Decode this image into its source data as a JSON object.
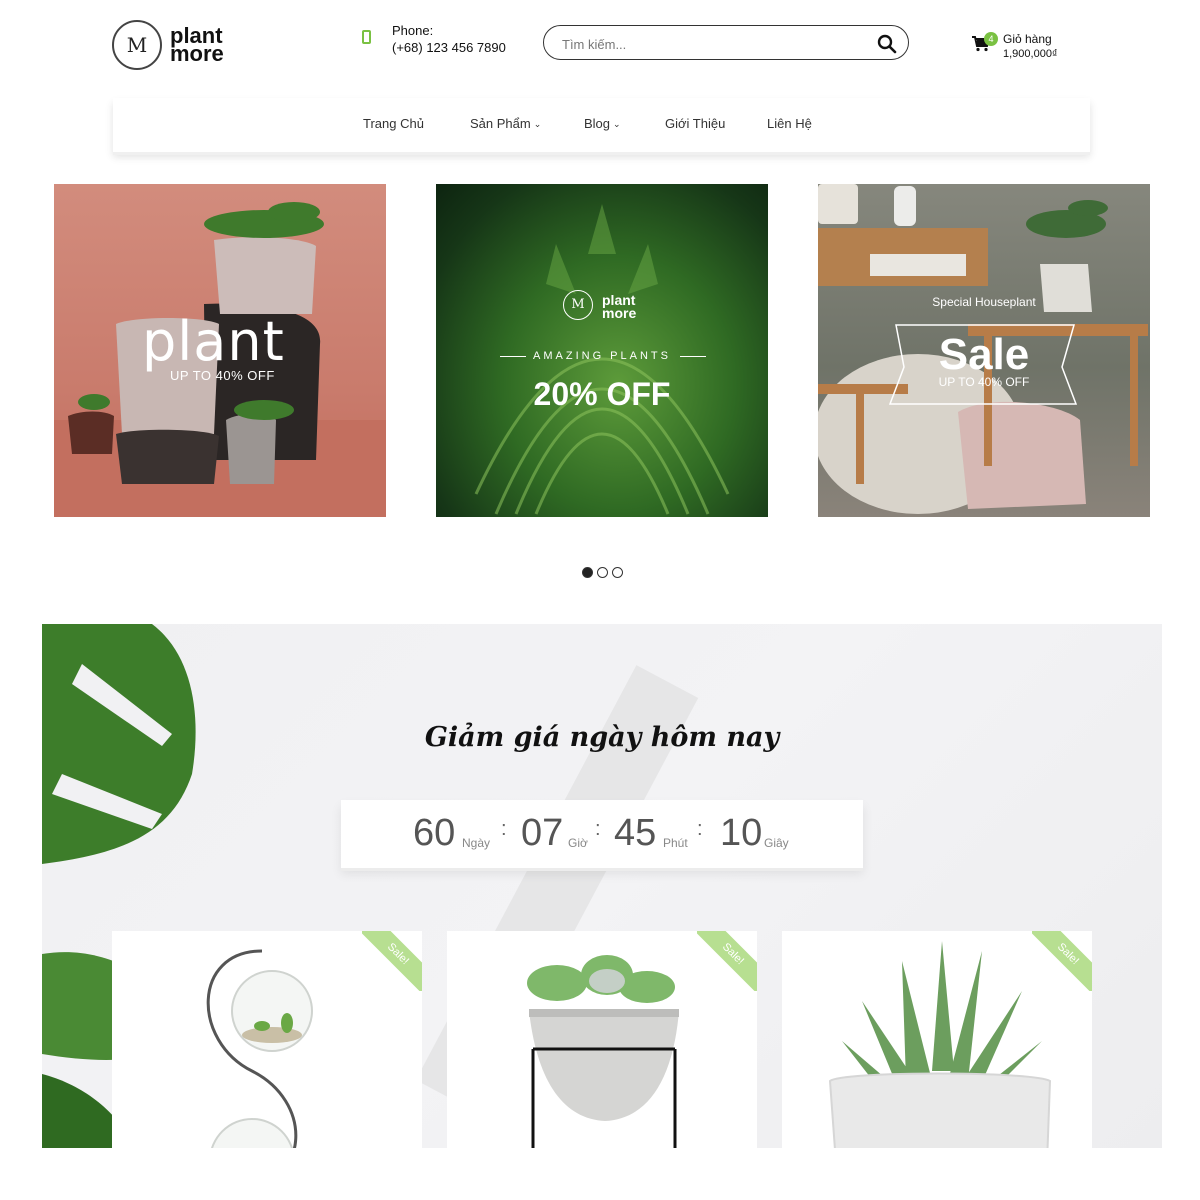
{
  "header": {
    "logo_line1": "plant",
    "logo_line2": "more",
    "logo_letter": "M",
    "phone_label": "Phone:",
    "phone_number": "(+68) 123 456 7890",
    "search_placeholder": "Tìm kiếm...",
    "cart_label": "Giỏ hàng",
    "cart_total": "1,900,000₫",
    "cart_count": "4"
  },
  "nav": {
    "items": [
      {
        "label": "Trang Chủ"
      },
      {
        "label": "Sản Phẩm"
      },
      {
        "label": "Blog"
      },
      {
        "label": "Giới Thiệu"
      },
      {
        "label": "Liên Hệ"
      }
    ]
  },
  "banners": [
    {
      "title": "plant",
      "subtitle": "UP TO 40% OFF"
    },
    {
      "logo_line1": "plant",
      "logo_line2": "more",
      "logo_letter": "M",
      "tagline": "AMAZING PLANTS",
      "offer": "20% OFF"
    },
    {
      "tag": "Special Houseplant",
      "title": "Sale",
      "subtitle": "UP TO 40% OFF"
    }
  ],
  "slider": {
    "active_index": 0,
    "count": 3
  },
  "deals": {
    "title": "Giảm giá ngày hôm nay",
    "countdown": [
      {
        "value": "60",
        "unit": "Ngày"
      },
      {
        "value": "07",
        "unit": "Giờ"
      },
      {
        "value": "45",
        "unit": "Phút"
      },
      {
        "value": "10",
        "unit": "Giây"
      }
    ],
    "products": [
      {
        "badge": "Sale!"
      },
      {
        "badge": "Sale!"
      },
      {
        "badge": "Sale!"
      }
    ]
  },
  "colors": {
    "accent_green": "#7ac142",
    "sale_ribbon": "#b7df91",
    "text_dark": "#222222"
  }
}
